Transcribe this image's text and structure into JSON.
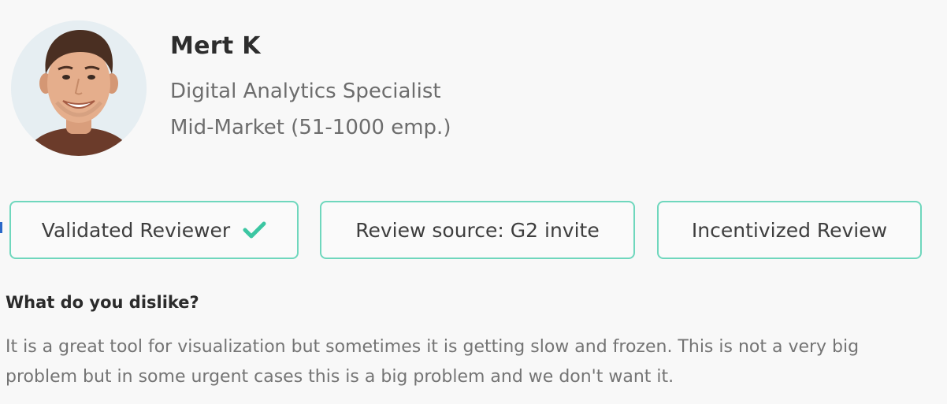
{
  "reviewer": {
    "name": "Mert K",
    "title": "Digital Analytics Specialist",
    "segment": "Mid-Market (51-1000 emp.)"
  },
  "badges": {
    "validated": "Validated Reviewer",
    "source": "Review source: G2 invite",
    "incentivized": "Incentivized Review"
  },
  "colors": {
    "badge_border": "#6fd7bd",
    "check": "#3cc6a2"
  },
  "icons": {
    "validated_icon": "check-icon"
  },
  "review": {
    "question": "What do you dislike?",
    "answer_line1": "It is a great tool for visualization but sometimes it is getting slow and frozen. This is not a very big",
    "answer_line2": "problem but in some urgent cases this is a big problem and we don't want it."
  }
}
